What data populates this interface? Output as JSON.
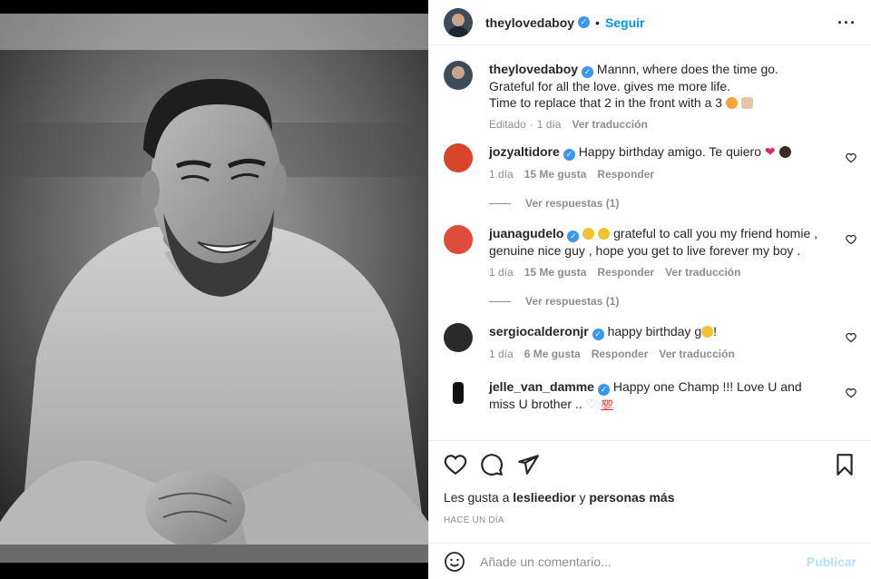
{
  "header": {
    "username": "theylovedaboy",
    "follow_label": "Seguir",
    "separator": "•"
  },
  "caption": {
    "username": "theylovedaboy",
    "text_line1": "Mannn, where does the time go.",
    "text_line2": "Grateful for all the love. gives me more life.",
    "text_line3": "Time to replace that 2 in the front with a 3",
    "meta_edited": "Editado",
    "meta_time": "1 día",
    "meta_translate": "Ver traducción"
  },
  "comments": [
    {
      "username": "jozyaltidore",
      "text": "Happy birthday amigo. Te quiero",
      "time": "1 día",
      "likes": "15 Me gusta",
      "reply": "Responder",
      "replies": "Ver respuestas (1)",
      "avatar_color": "#d9452b"
    },
    {
      "username": "juanagudelo",
      "text": "grateful to call you my friend homie , genuine nice guy , hope you get to live forever my boy .",
      "time": "1 día",
      "likes": "15 Me gusta",
      "reply": "Responder",
      "translate": "Ver traducción",
      "replies": "Ver respuestas (1)",
      "avatar_color": "#e04c3a"
    },
    {
      "username": "sergiocalderonjr",
      "text": "happy birthday g",
      "text_end": "!",
      "time": "1 día",
      "likes": "6 Me gusta",
      "reply": "Responder",
      "translate": "Ver traducción",
      "avatar_color": "#2a2a2a"
    },
    {
      "username": "jelle_van_damme",
      "text": "Happy one Champ !!! Love U and miss U brother ..",
      "avatar_color": "#111111"
    }
  ],
  "actions": {
    "likes_prefix": "Les gusta a",
    "likes_user": "leslieedior",
    "likes_conj": "y",
    "likes_others": "personas más",
    "time": "HACE UN DÍA"
  },
  "add_comment": {
    "placeholder": "Añade un comentario...",
    "publish_label": "Publicar"
  },
  "colors": {
    "accent": "#0095f6",
    "verified": "#3897f0",
    "muted": "#8e8e8e",
    "publish_disabled": "#b2dffc"
  }
}
